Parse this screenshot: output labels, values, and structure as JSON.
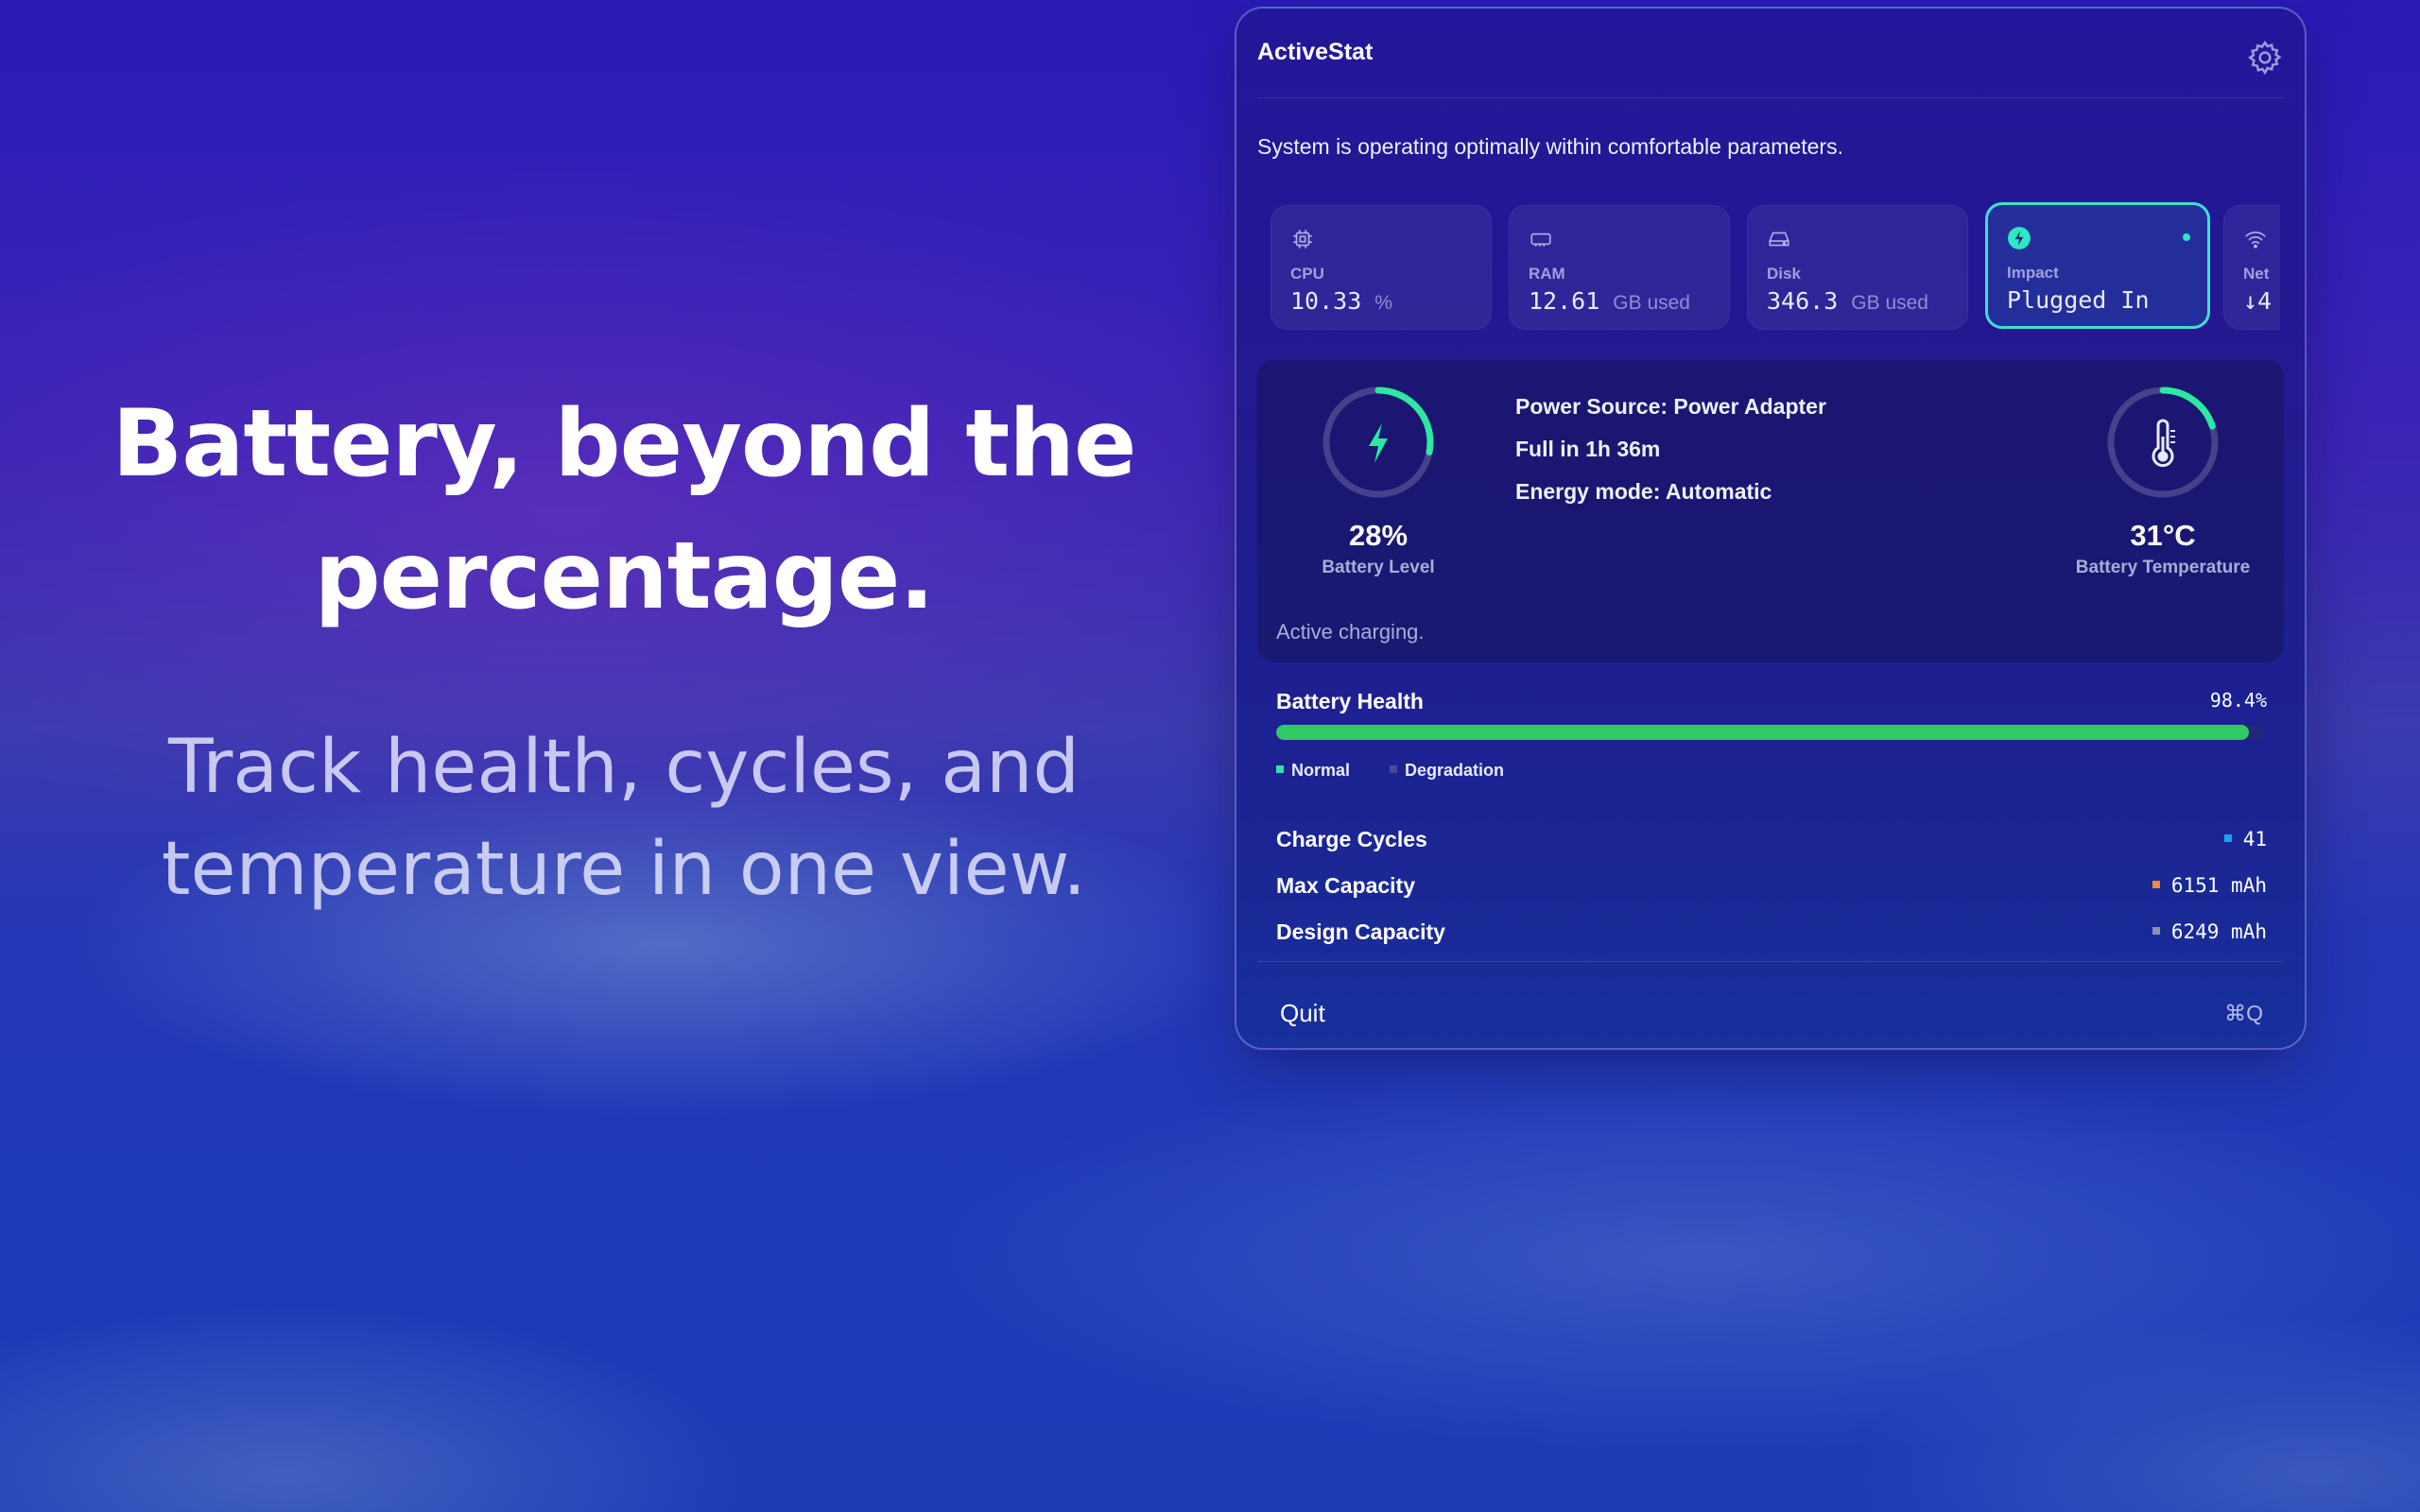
{
  "hero": {
    "headline_line1": "Battery, beyond the",
    "headline_line2": "percentage.",
    "sub_line1": "Track health, cycles, and",
    "sub_line2": "temperature in one view."
  },
  "app": {
    "title": "ActiveStat",
    "settings_icon": "gear-icon",
    "status_message": "System is operating optimally within comfortable parameters."
  },
  "tiles": [
    {
      "label": "CPU",
      "value": "10.33",
      "unit": "%",
      "icon": "cpu-icon"
    },
    {
      "label": "RAM",
      "value": "12.61",
      "unit": "GB used",
      "icon": "memory-icon"
    },
    {
      "label": "Disk",
      "value": "346.3",
      "unit": "GB used",
      "icon": "disk-icon"
    },
    {
      "label": "Impact",
      "value": "Plugged In",
      "unit": "",
      "icon": "bolt-icon",
      "active": true
    },
    {
      "label": "Net",
      "value": "↓4",
      "unit": "",
      "icon": "wifi-icon"
    }
  ],
  "battery": {
    "level_text": "28%",
    "level_fraction": 0.28,
    "level_label": "Battery Level",
    "power_source": "Power Source: Power Adapter",
    "time_to_full": "Full in 1h 36m",
    "energy_mode": "Energy mode: Automatic",
    "temperature_text": "31°C",
    "temperature_fraction": 0.2,
    "temperature_label": "Battery Temperature",
    "note": "Active charging."
  },
  "health": {
    "label": "Battery Health",
    "value_text": "98.4%",
    "fraction": 0.984,
    "legend_normal": "Normal",
    "legend_degradation": "Degradation"
  },
  "stats": [
    {
      "label": "Charge Cycles",
      "value": "41",
      "color": "#1da1f2"
    },
    {
      "label": "Max Capacity",
      "value": "6151 mAh",
      "color": "#f08a3c"
    },
    {
      "label": "Design Capacity",
      "value": "6249 mAh",
      "color": "#8c8fb8"
    }
  ],
  "footer": {
    "quit_label": "Quit",
    "shortcut": "⌘Q"
  },
  "colors": {
    "accent": "#2de8c2",
    "health_bar": "#2ecb62"
  }
}
